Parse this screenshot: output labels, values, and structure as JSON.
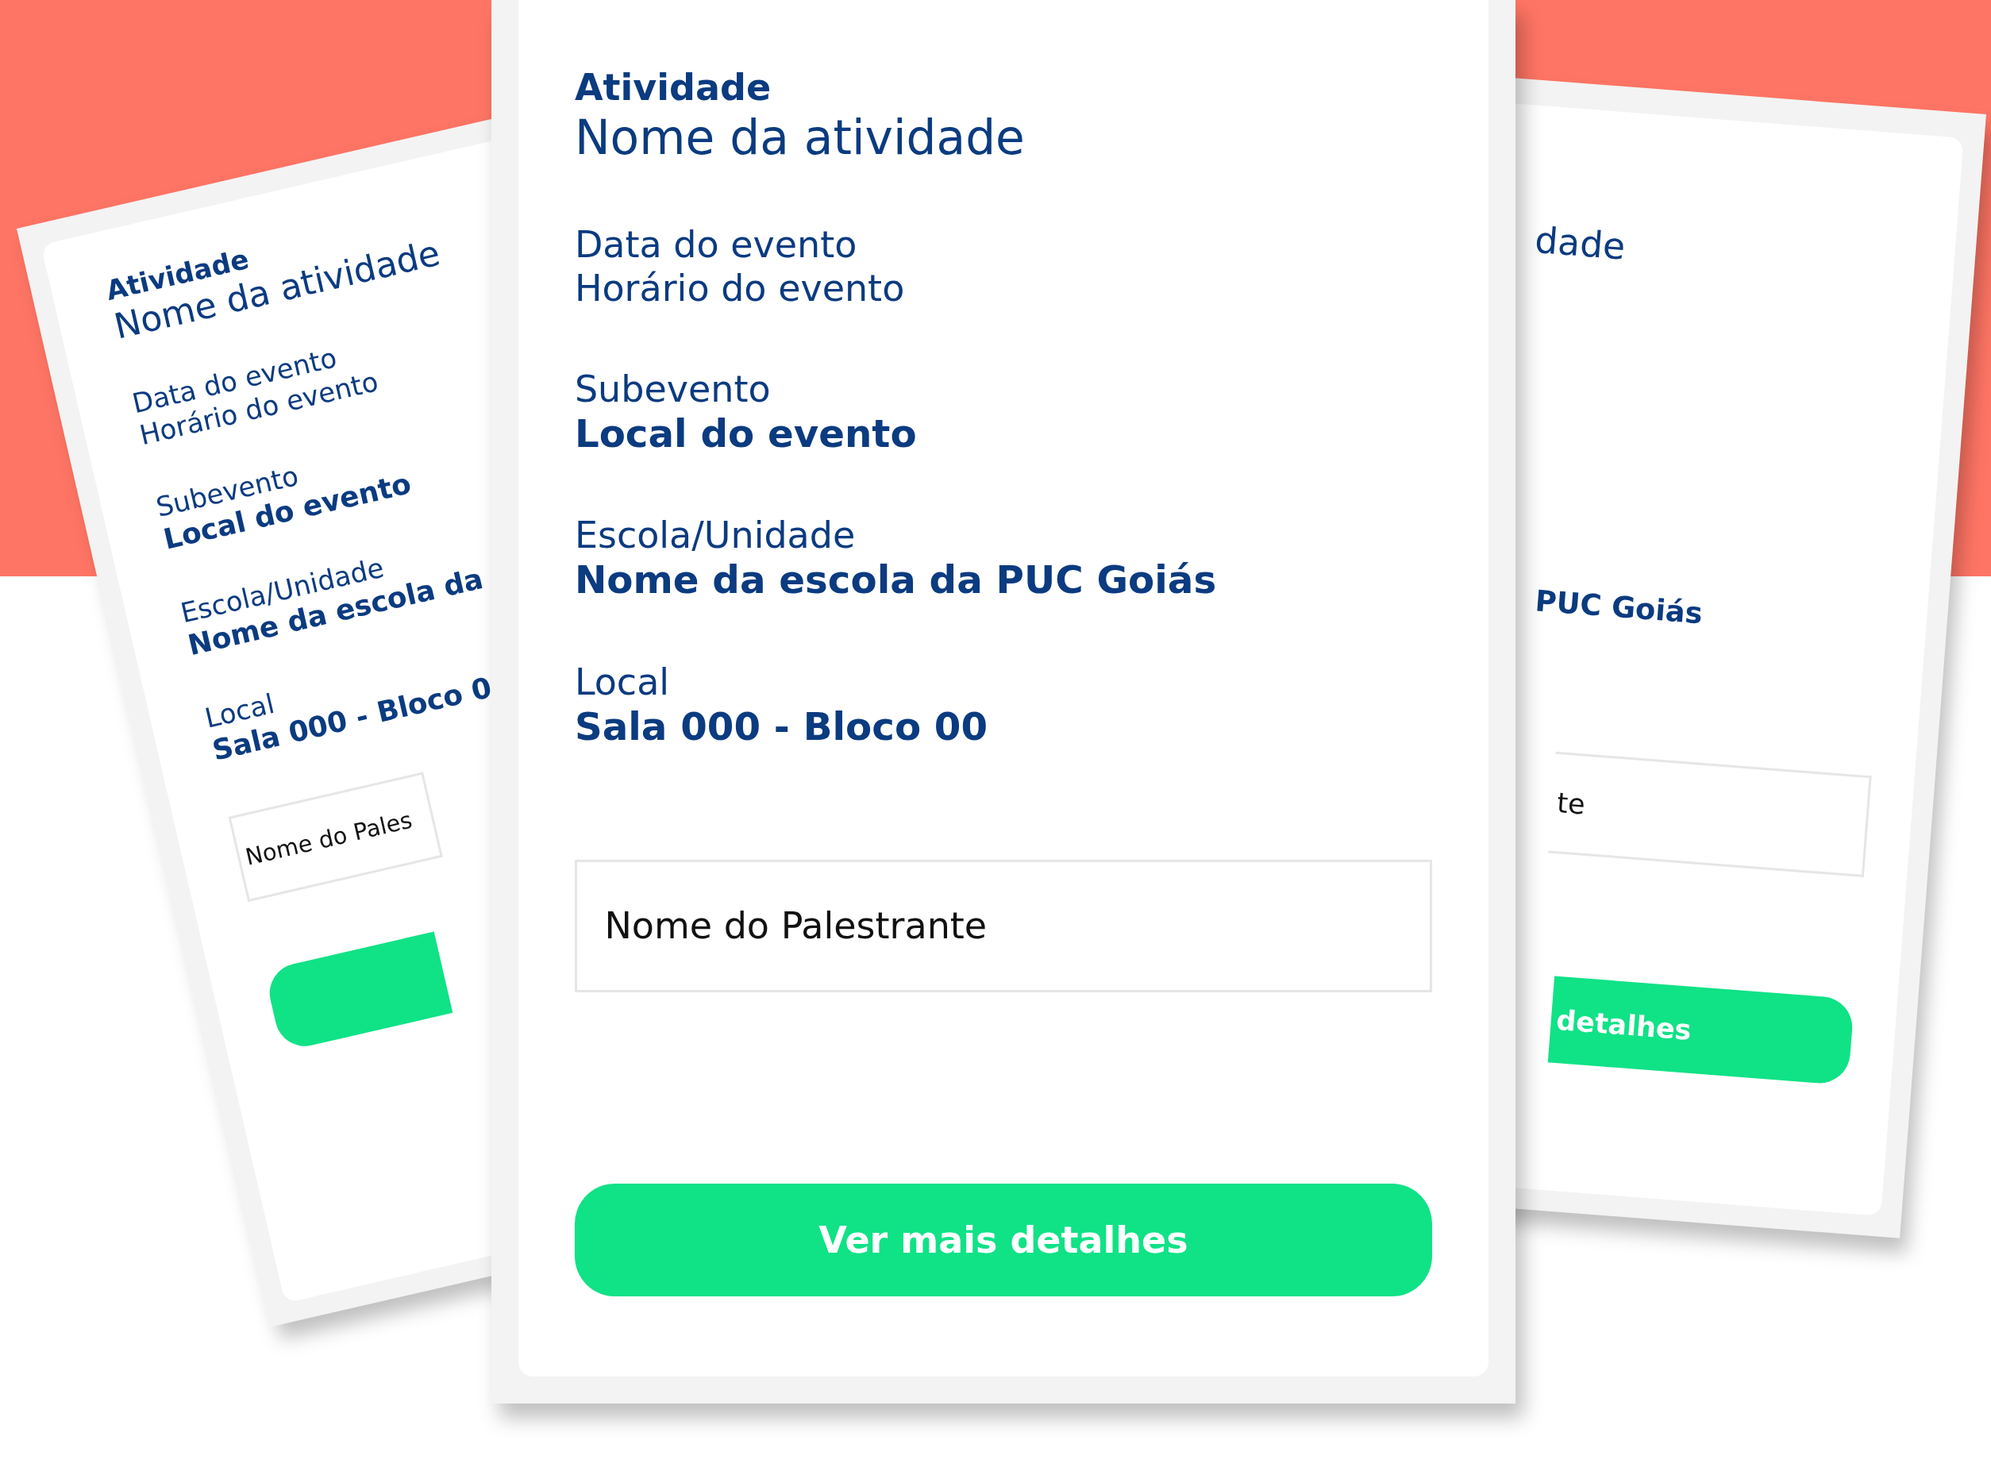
{
  "cards": [
    {
      "kind": "left",
      "groups": [
        {
          "lines": [
            {
              "kind": "heading",
              "text": "Atividade"
            },
            {
              "kind": "title",
              "text": "Nome da atividade"
            }
          ]
        },
        {
          "lines": [
            {
              "kind": "plain",
              "text": "Data do evento"
            },
            {
              "kind": "plain",
              "text": "Horário do evento"
            }
          ]
        },
        {
          "lines": [
            {
              "kind": "plain",
              "text": "Subevento"
            },
            {
              "kind": "strong",
              "text": "Local do evento"
            }
          ]
        },
        {
          "lines": [
            {
              "kind": "plain",
              "text": "Escola/Unidade"
            },
            {
              "kind": "strong",
              "text": "Nome da escola da"
            }
          ]
        },
        {
          "lines": [
            {
              "kind": "plain",
              "text": "Local"
            },
            {
              "kind": "strong",
              "text": "Sala 000 - Bloco 0"
            }
          ]
        }
      ],
      "field": {
        "value": "Nome do Pales"
      },
      "button": {
        "kind": "unlabelled"
      }
    },
    {
      "kind": "right",
      "groups": [
        {
          "lines": [
            {
              "kind": "title",
              "text": "dade"
            }
          ]
        },
        {
          "lines": [
            {
              "kind": "strong",
              "text": "PUC Goiás"
            }
          ]
        }
      ],
      "field": {
        "value": "te"
      },
      "button": {
        "kind": "labelled",
        "label": "detalhes"
      }
    },
    {
      "kind": "center",
      "groups": [
        {
          "lines": [
            {
              "kind": "heading",
              "text": "Atividade"
            },
            {
              "kind": "title",
              "text": "Nome da atividade"
            }
          ]
        },
        {
          "lines": [
            {
              "kind": "plain",
              "text": "Data do evento"
            },
            {
              "kind": "plain",
              "text": "Horário do evento"
            }
          ]
        },
        {
          "lines": [
            {
              "kind": "plain",
              "text": "Subevento"
            },
            {
              "kind": "strong",
              "text": "Local do evento"
            }
          ]
        },
        {
          "lines": [
            {
              "kind": "plain",
              "text": "Escola/Unidade"
            },
            {
              "kind": "strong",
              "text": "Nome da escola da PUC Goiás"
            }
          ]
        },
        {
          "lines": [
            {
              "kind": "plain",
              "text": "Local"
            },
            {
              "kind": "strong",
              "text": "Sala 000 - Bloco 00"
            }
          ]
        }
      ],
      "field": {
        "value": "Nome do Palestrante"
      },
      "button": {
        "kind": "labelled",
        "label": "Ver mais detalhes"
      }
    }
  ]
}
